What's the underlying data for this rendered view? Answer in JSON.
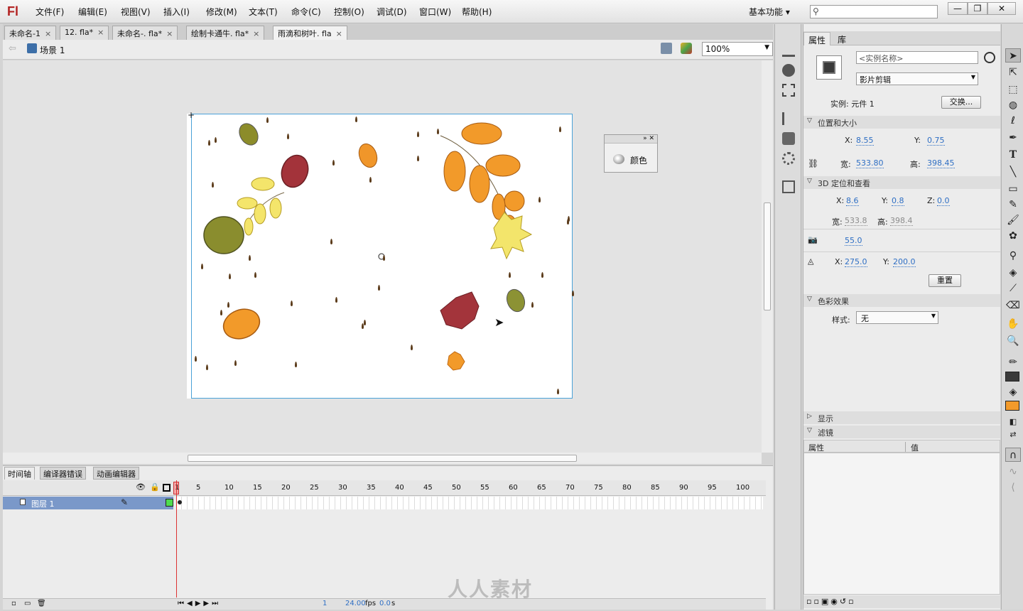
{
  "app": {
    "logo": "Fl",
    "workspace": "基本功能"
  },
  "menu": [
    "文件(F)",
    "编辑(E)",
    "视图(V)",
    "插入(I)",
    "修改(M)",
    "文本(T)",
    "命令(C)",
    "控制(O)",
    "调试(D)",
    "窗口(W)",
    "帮助(H)"
  ],
  "window_buttons": [
    "—",
    "❐",
    "✕"
  ],
  "tabs": [
    {
      "label": "未命名-1",
      "mark": "×"
    },
    {
      "label": "12. fla*",
      "mark": "×"
    },
    {
      "label": "未命名-. fla*",
      "mark": "×"
    },
    {
      "label": "绘制卡通牛. fla*",
      "mark": "×"
    },
    {
      "label": "雨滴和树叶. fla",
      "mark": "×"
    }
  ],
  "scene": {
    "label": "场景 1",
    "zoom": "100%"
  },
  "color_panel": {
    "label": "颜色"
  },
  "timeline": {
    "tabs": [
      "时间轴",
      "编译器错误",
      "动画编辑器"
    ],
    "frame_numbers": [
      "1",
      "5",
      "10",
      "15",
      "20",
      "25",
      "30",
      "35",
      "40",
      "45",
      "50",
      "55",
      "60",
      "65",
      "70",
      "75",
      "80",
      "85",
      "90",
      "95",
      "100"
    ],
    "layer_name": "图层 1",
    "current_frame": "1",
    "fps": "24.00",
    "fps_unit": "fps",
    "time": "0.0",
    "time_unit": "s"
  },
  "properties": {
    "tabs": [
      "属性",
      "库"
    ],
    "instance_name_placeholder": "<实例名称>",
    "type": "影片剪辑",
    "instance_label": "实例: 元件 1",
    "swap_button": "交换...",
    "sec_position": "位置和大小",
    "x_label": "X:",
    "x": "8.55",
    "y_label": "Y:",
    "y": "0.75",
    "w_label": "宽:",
    "w": "533.80",
    "h_label": "高:",
    "h": "398.45",
    "sec_3d": "3D 定位和查看",
    "x3d_label": "X:",
    "x3d": "8.6",
    "y3d_label": "Y:",
    "y3d": "0.8",
    "z3d_label": "Z:",
    "z3d": "0.0",
    "w3d_label": "宽:",
    "w3d": "533.8",
    "h3d_label": "高:",
    "h3d": "398.4",
    "perspective": "55.0",
    "vx_label": "X:",
    "vx": "275.0",
    "vy_label": "Y:",
    "vy": "200.0",
    "reset_button": "重置",
    "sec_color": "色彩效果",
    "style_label": "样式:",
    "style_value": "无",
    "sec_display": "显示",
    "sec_filter": "滤镜",
    "filter_col1": "属性",
    "filter_col2": "值"
  },
  "watermark": "人人素材"
}
